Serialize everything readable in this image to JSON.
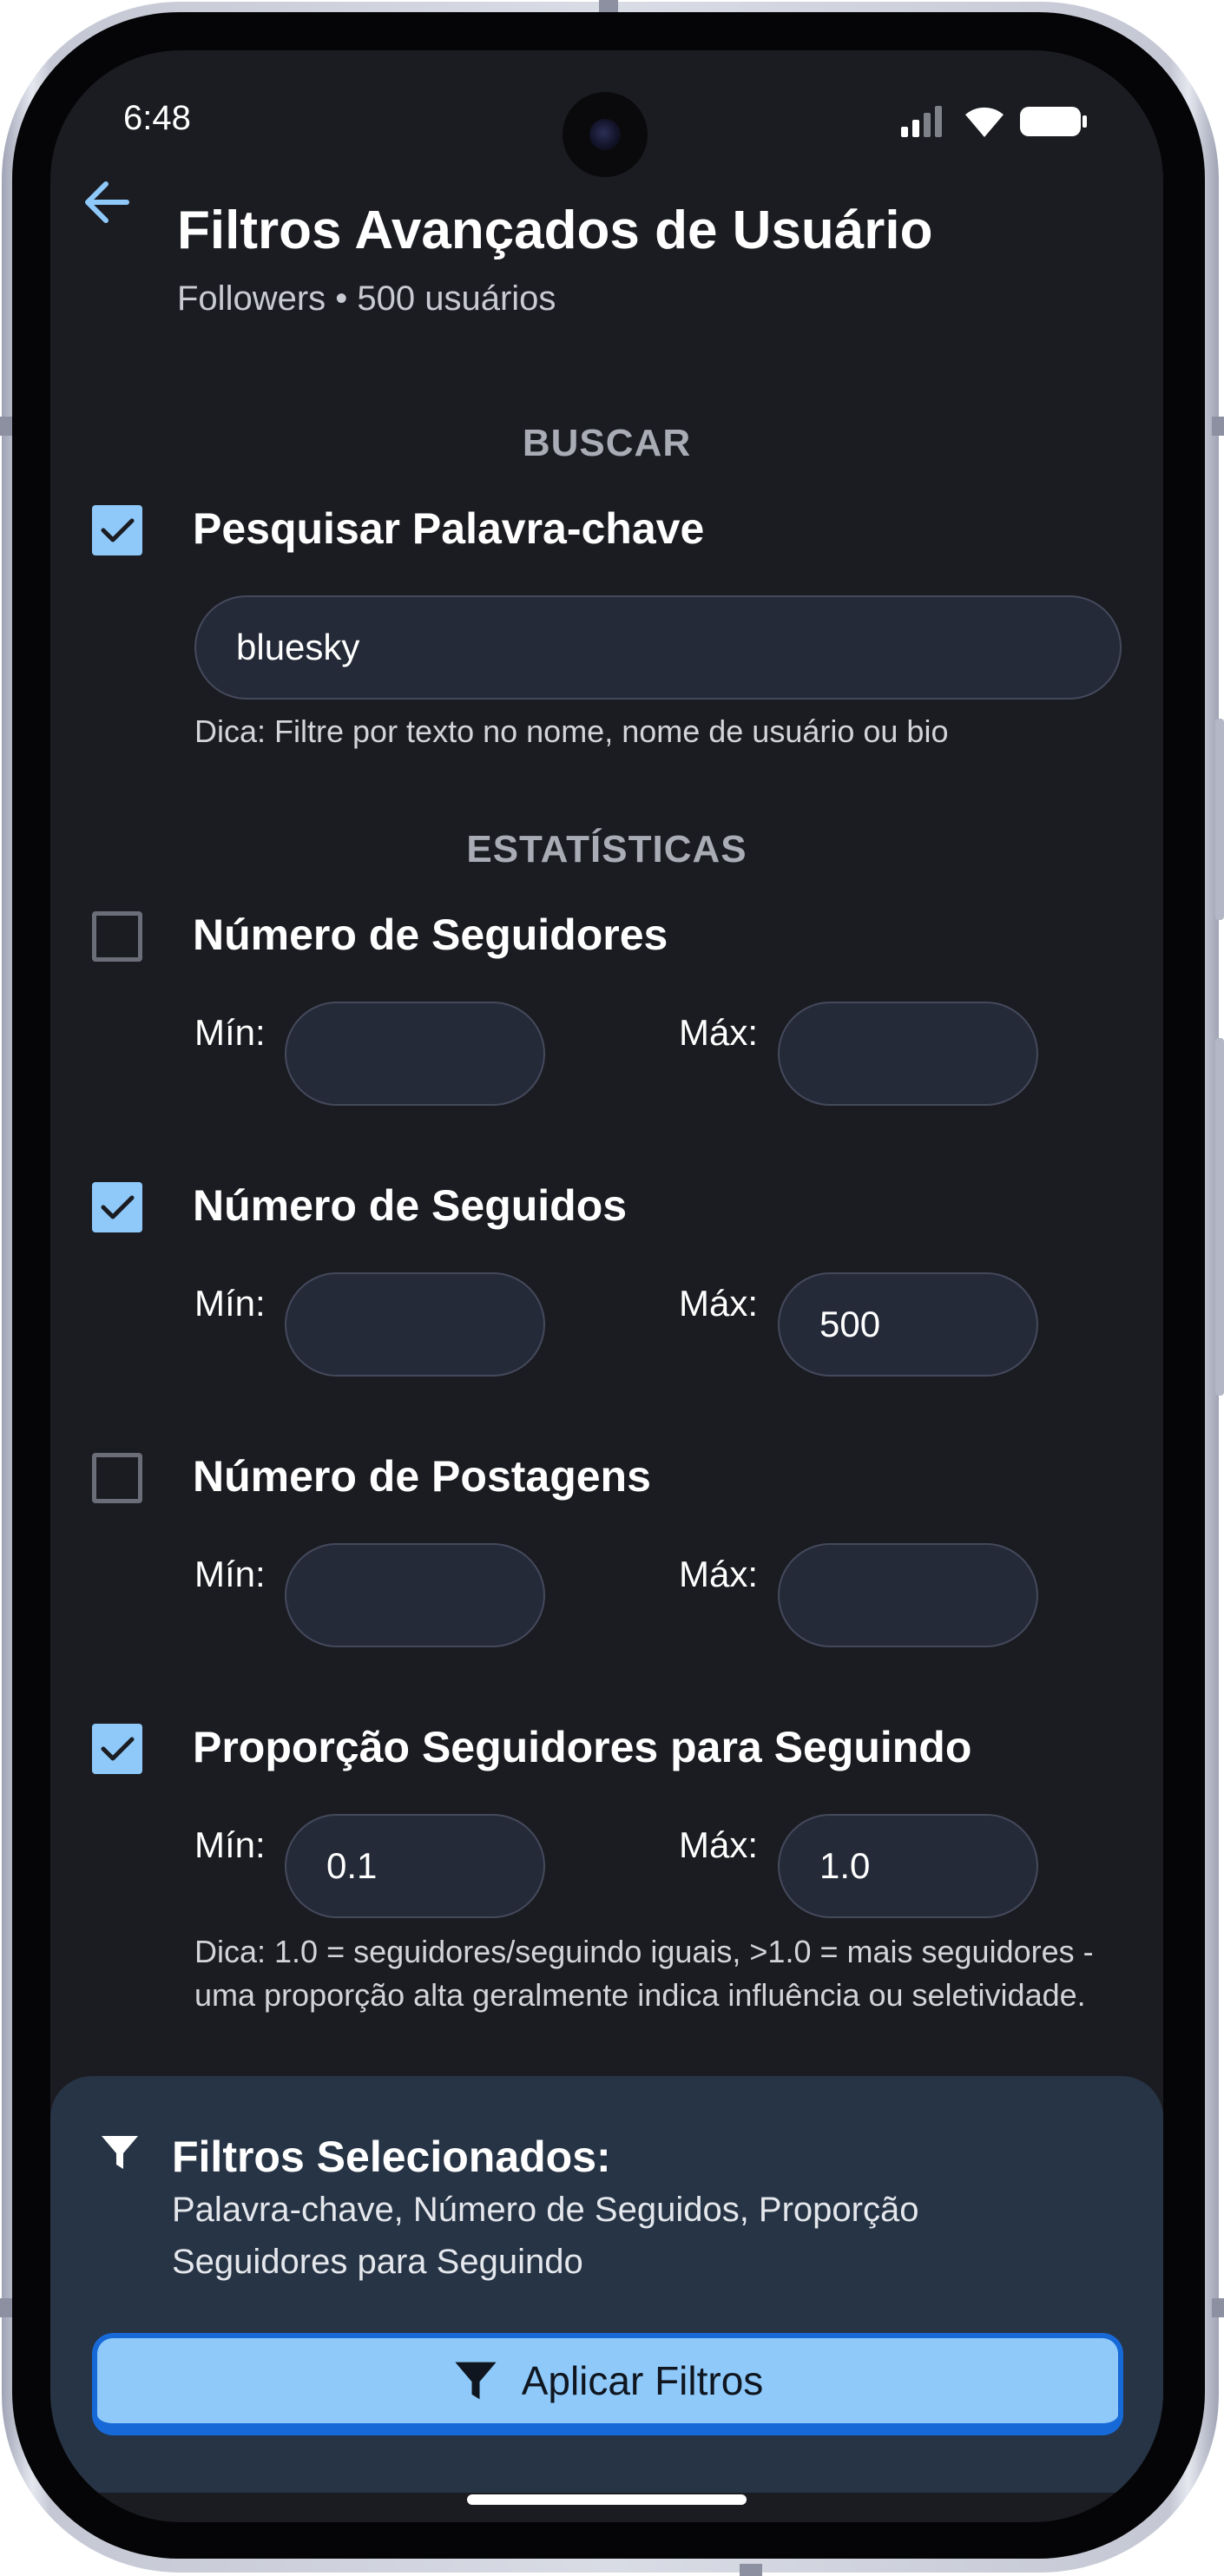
{
  "status_bar": {
    "time": "6:48",
    "icons": [
      "signal-icon",
      "wifi-icon",
      "battery-icon"
    ]
  },
  "header": {
    "title": "Filtros Avançados de Usuário",
    "subtitle": "Followers • 500 usuários",
    "back_icon": "arrow-left-icon"
  },
  "sections": {
    "search": "BUSCAR",
    "stats": "ESTATÍSTICAS"
  },
  "keyword": {
    "label": "Pesquisar Palavra-chave",
    "checked": true,
    "value": "bluesky",
    "hint": "Dica: Filtre por texto no nome, nome de usuário ou bio"
  },
  "filters": [
    {
      "label": "Número de Seguidores",
      "checked": false,
      "min_label": "Mín:",
      "max_label": "Máx:",
      "min": "",
      "max": ""
    },
    {
      "label": "Número de Seguidos",
      "checked": true,
      "min_label": "Mín:",
      "max_label": "Máx:",
      "min": "",
      "max": "500"
    },
    {
      "label": "Número de Postagens",
      "checked": false,
      "min_label": "Mín:",
      "max_label": "Máx:",
      "min": "",
      "max": ""
    },
    {
      "label": "Proporção Seguidores para Seguindo",
      "checked": true,
      "min_label": "Mín:",
      "max_label": "Máx:",
      "min": "0.1",
      "max": "1.0",
      "hint_line1": "Dica: 1.0 = seguidores/seguindo iguais, >1.0 = mais seguidores -",
      "hint_line2": "uma proporção alta geralmente indica influência ou seletividade."
    }
  ],
  "summary": {
    "title": "Filtros Selecionados:",
    "text": "Palavra-chave, Número de Seguidos, Proporção Seguidores para Seguindo",
    "icon": "filter-icon"
  },
  "apply_button": {
    "label": "Aplicar Filtros",
    "icon": "filter-icon"
  },
  "colors": {
    "background": "#1b1c21",
    "accent": "#8ec9fa",
    "button_border": "#1769d8",
    "panel": "#273445",
    "input": "#252a39"
  }
}
